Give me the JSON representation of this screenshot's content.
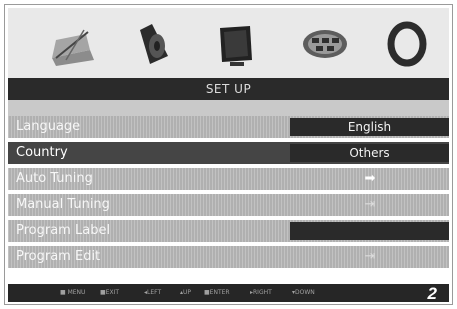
{
  "title": "SET UP",
  "icons": [
    {
      "name": "picture-settings-icon",
      "selected": false
    },
    {
      "name": "speaker-icon",
      "selected": false
    },
    {
      "name": "tv-screen-icon",
      "selected": true
    },
    {
      "name": "connector-icon",
      "selected": false
    },
    {
      "name": "ring-icon",
      "selected": false
    }
  ],
  "menu": [
    {
      "label": "Language",
      "value": "English",
      "type": "value"
    },
    {
      "label": "Country",
      "value": "Others",
      "type": "value",
      "selected": true
    },
    {
      "label": "Auto Tuning",
      "type": "arrow"
    },
    {
      "label": "Manual Tuning",
      "type": "arrow"
    },
    {
      "label": "Program Label",
      "type": "empty"
    },
    {
      "label": "Program Edit",
      "type": "arrow"
    }
  ],
  "footer": {
    "hints": [
      "MENU",
      "EXIT",
      "LEFT",
      "UP",
      "ENTER",
      "RIGHT",
      "DOWN"
    ],
    "page": "2"
  }
}
